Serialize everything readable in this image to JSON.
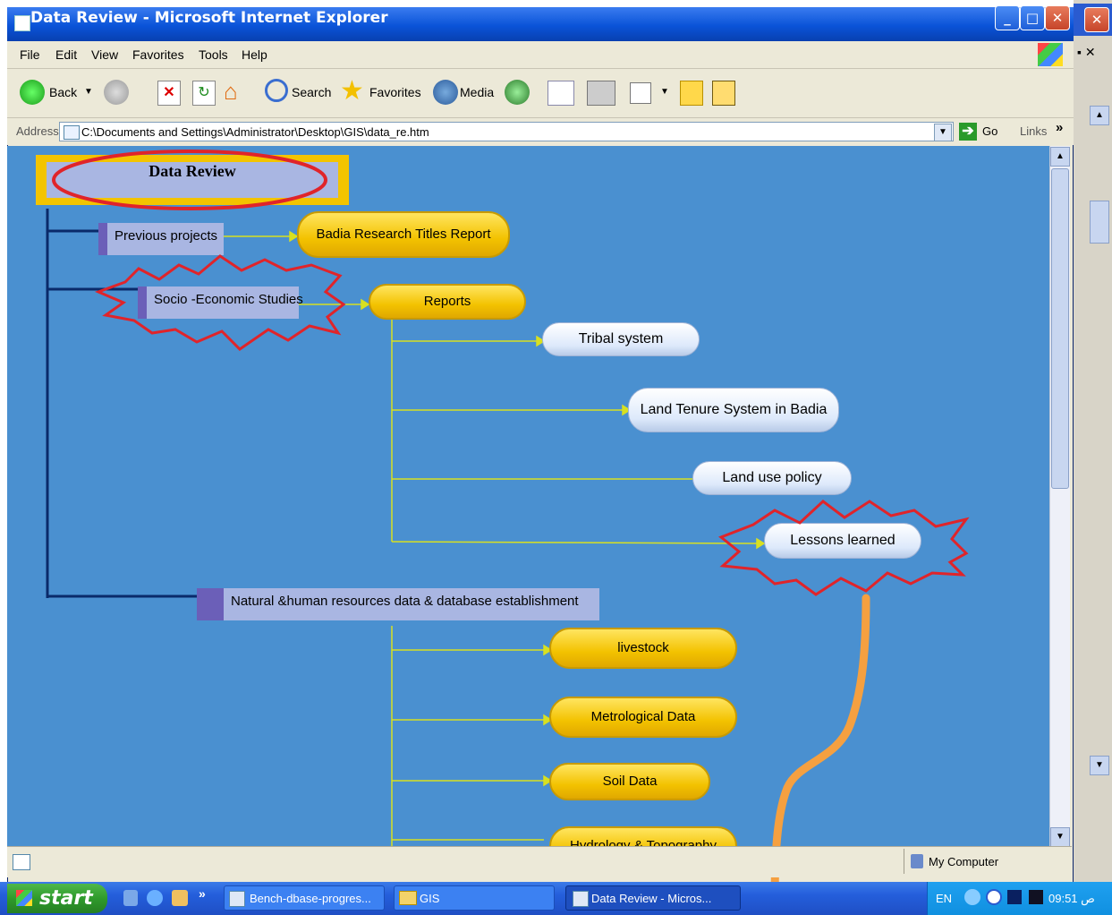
{
  "window": {
    "title": "Data Review - Microsoft Internet Explorer",
    "minimize": "_",
    "maximize": "□",
    "close": "✕"
  },
  "menu": [
    "File",
    "Edit",
    "View",
    "Favorites",
    "Tools",
    "Help"
  ],
  "toolbar": {
    "back": "Back",
    "search": "Search",
    "favorites": "Favorites",
    "media": "Media"
  },
  "address": {
    "label": "Address",
    "value": "C:\\Documents and Settings\\Administrator\\Desktop\\GIS\\data_re.htm",
    "go": "Go",
    "links": "Links",
    "chevron": "»"
  },
  "diagram": {
    "root": "Data Review",
    "previous_projects": "Previous projects",
    "badia_report": "Badia Research Titles Report",
    "socio_economic": "Socio -Economic Studies",
    "reports": "Reports",
    "tribal_system": "Tribal system",
    "land_tenure": "Land Tenure System in Badia",
    "land_use": "Land use policy",
    "lessons_learned": "Lessons learned",
    "natural_resources": "Natural &human resources data & database establishment",
    "livestock": "livestock",
    "metrological": "Metrological Data",
    "soil": "Soil Data",
    "hydrology_partial": "Hydrology & Topography"
  },
  "status": {
    "zone": "My Computer"
  },
  "taskbar": {
    "start": "start",
    "tasks": [
      "Bench-dbase-progres...",
      "GIS",
      "Data Review - Micros..."
    ],
    "lang": "EN",
    "time": "09:51 ص"
  },
  "colors": {
    "content_bg": "#4a90d0",
    "annotation_red": "#e0242a",
    "arrow_orange": "#f5a040",
    "line_yellow": "#d8e020",
    "tree_line_dark": "#0a2a6a"
  }
}
